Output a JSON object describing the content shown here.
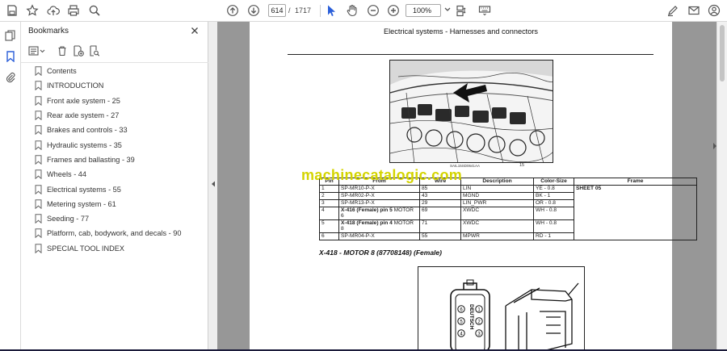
{
  "toolbar": {
    "page_current": "614",
    "page_separator": "/",
    "page_total": "1717",
    "zoom": "100%"
  },
  "bookmarks": {
    "title": "Bookmarks",
    "items": [
      {
        "label": "Contents"
      },
      {
        "label": "INTRODUCTION"
      },
      {
        "label": "Front axle system - 25"
      },
      {
        "label": "Rear axle system - 27"
      },
      {
        "label": "Brakes and controls - 33"
      },
      {
        "label": "Hydraulic systems - 35"
      },
      {
        "label": "Frames and ballasting - 39"
      },
      {
        "label": "Wheels - 44"
      },
      {
        "label": "Electrical systems - 55"
      },
      {
        "label": "Metering system - 61"
      },
      {
        "label": "Seeding - 77"
      },
      {
        "label": "Platform, cab, bodywork, and decals - 90"
      },
      {
        "label": "SPECIAL TOOL INDEX"
      }
    ]
  },
  "document": {
    "heading": "Electrical systems - Harnesses and connectors",
    "figure_code": "SAIL15SD0641AA",
    "figure_number": "15",
    "watermark": "machinecatalogic.com",
    "table": {
      "headers": [
        "Pin",
        "From",
        "Wire",
        "Description",
        "Color-Size",
        "Frame"
      ],
      "rows": [
        {
          "pin": "1",
          "from": "SP-MR10-P-X",
          "from_bold": "",
          "from_rest": "",
          "wire": "85",
          "desc": "LIN",
          "color": "YE - 0.8"
        },
        {
          "pin": "2",
          "from": "SP-MR02-P-X",
          "from_bold": "",
          "from_rest": "",
          "wire": "43",
          "desc": "MGND",
          "color": "BK - 1"
        },
        {
          "pin": "3",
          "from": "SP-MR13-P-X",
          "from_bold": "",
          "from_rest": "",
          "wire": "29",
          "desc": "LIN_PWR",
          "color": "OR - 0.8"
        },
        {
          "pin": "4",
          "from": "",
          "from_bold": "X-416 (Female) pin 5",
          "from_rest": " MOTOR 6",
          "wire": "69",
          "desc": "XWDC",
          "color": "WH - 0.8"
        },
        {
          "pin": "5",
          "from": "",
          "from_bold": "X-418 (Female) pin 4",
          "from_rest": " MOTOR 8",
          "wire": "71",
          "desc": "XWDC",
          "color": "WH - 0.8"
        },
        {
          "pin": "6",
          "from": "SP-MR04-P-X",
          "from_bold": "",
          "from_rest": "",
          "wire": "55",
          "desc": "MPWR",
          "color": "RD - 1"
        }
      ],
      "frame_value": "SHEET 05"
    },
    "section_title": "X-418 - MOTOR 8 (87708148) (Female)",
    "connector_brand": "DEUTSCH",
    "connector_pins": [
      "1",
      "2",
      "3",
      "4",
      "5",
      "6"
    ]
  }
}
